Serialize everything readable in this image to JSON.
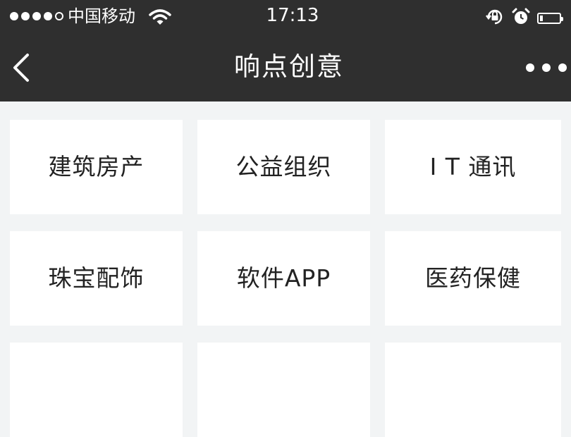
{
  "status_bar": {
    "carrier": "中国移动",
    "time": "17:13",
    "signal_bars": 4,
    "signal_max": 5,
    "battery_level": 0.15
  },
  "nav": {
    "title": "响点创意"
  },
  "categories": [
    {
      "label": "建筑房产"
    },
    {
      "label": "公益组织"
    },
    {
      "label": "I T 通讯"
    },
    {
      "label": "珠宝配饰"
    },
    {
      "label": "软件APP"
    },
    {
      "label": "医药保健"
    },
    {
      "label": ""
    },
    {
      "label": ""
    },
    {
      "label": ""
    }
  ],
  "colors": {
    "header_bg": "#2f2f2f",
    "page_bg": "#f2f4f5",
    "tile_bg": "#ffffff",
    "text": "#222222"
  },
  "icons": {
    "back": "chevron-left-icon",
    "more": "ellipsis-icon",
    "wifi": "wifi-icon",
    "orientation_lock": "orientation-lock-icon",
    "alarm": "alarm-clock-icon",
    "battery": "battery-icon"
  }
}
